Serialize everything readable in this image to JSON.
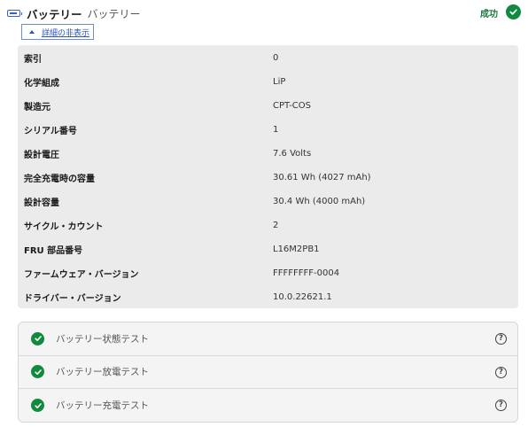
{
  "header": {
    "icon": "battery-icon",
    "title": "バッテリー",
    "subtitle": "バッテリー",
    "status_label": "成功",
    "status_icon": "check-circle-icon"
  },
  "toggle": {
    "label": "詳細の非表示",
    "icon": "caret-up-icon"
  },
  "details": [
    {
      "label": "索引",
      "value": "0"
    },
    {
      "label": "化学組成",
      "value": "LiP"
    },
    {
      "label": "製造元",
      "value": "CPT-COS"
    },
    {
      "label": "シリアル番号",
      "value": "1"
    },
    {
      "label": "設計電圧",
      "value": "7.6 Volts"
    },
    {
      "label": "完全充電時の容量",
      "value": "30.61 Wh (4027 mAh)"
    },
    {
      "label": "設計容量",
      "value": "30.4 Wh (4000 mAh)"
    },
    {
      "label": "サイクル・カウント",
      "value": "2"
    },
    {
      "label": "FRU 部品番号",
      "value": "L16M2PB1"
    },
    {
      "label": "ファームウェア・バージョン",
      "value": "FFFFFFFF-0004"
    },
    {
      "label": "ドライバー・バージョン",
      "value": "10.0.22621.1"
    }
  ],
  "tests": [
    {
      "label": "バッテリー状態テスト",
      "status_icon": "check-circle-icon",
      "help_icon": "help-icon"
    },
    {
      "label": "バッテリー放電テスト",
      "status_icon": "check-circle-icon",
      "help_icon": "help-icon"
    },
    {
      "label": "バッテリー充電テスト",
      "status_icon": "check-circle-icon",
      "help_icon": "help-icon"
    }
  ],
  "colors": {
    "success": "#108a3e",
    "link": "#2b55b8",
    "panel": "#ebebeb"
  }
}
